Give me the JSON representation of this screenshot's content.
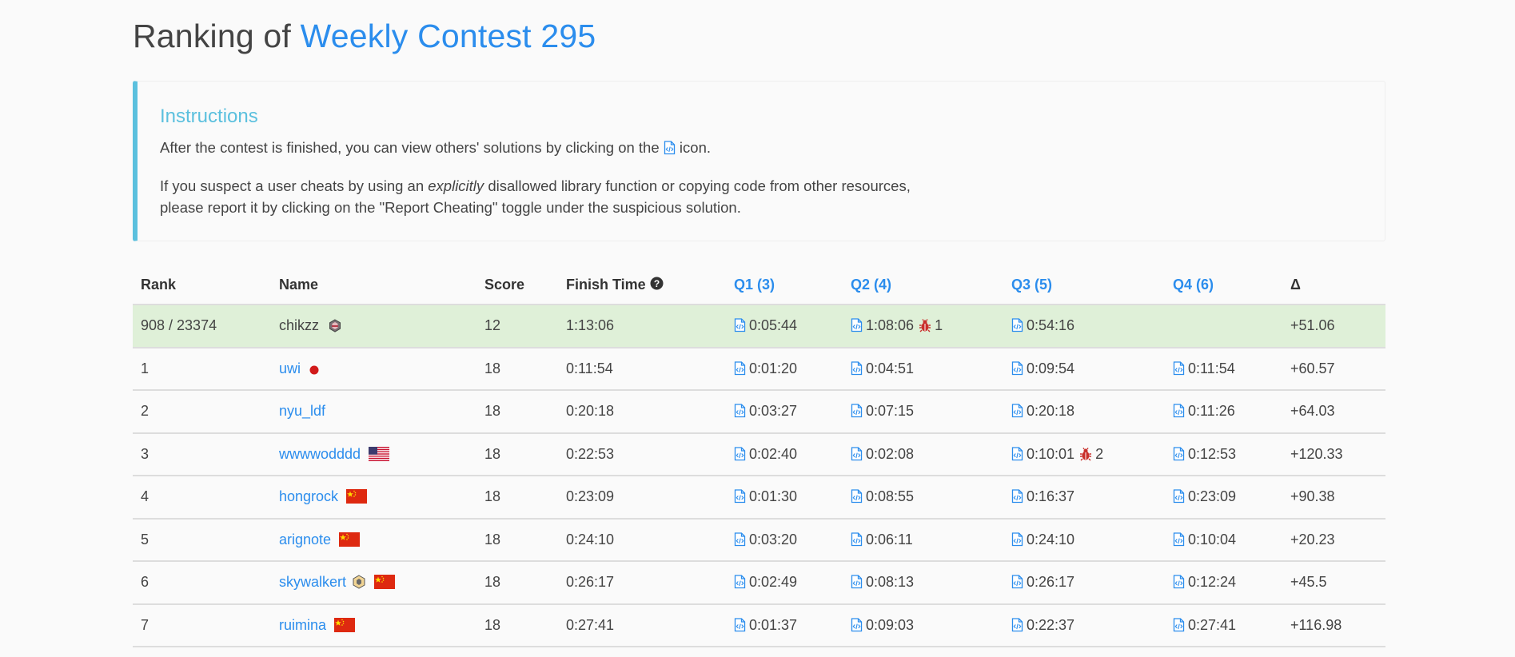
{
  "page": {
    "title_prefix": "Ranking of",
    "contest_name": "Weekly Contest 295"
  },
  "instructions": {
    "heading": "Instructions",
    "line1_before": "After the contest is finished, you can view others' solutions by clicking on the",
    "line1_after": "icon.",
    "line2_before": "If you suspect a user cheats by using an",
    "line2_em": "explicitly",
    "line2_after": "disallowed library function or copying code from other resources,",
    "line3": "please report it by clicking on the \"Report Cheating\" toggle under the suspicious solution."
  },
  "table": {
    "headers": {
      "rank": "Rank",
      "name": "Name",
      "score": "Score",
      "finish_time": "Finish Time",
      "q1": "Q1 (3)",
      "q2": "Q2 (4)",
      "q3": "Q3 (5)",
      "q4": "Q4 (6)",
      "delta": "Δ"
    },
    "my_row": {
      "rank": "908 / 23374",
      "name": "chikzz",
      "score": "12",
      "finish_time": "1:13:06",
      "q1": "0:05:44",
      "q2": "1:08:06",
      "q2_bugs": "1",
      "q3": "0:54:16",
      "q4": "",
      "delta": "+51.06"
    },
    "rows": [
      {
        "rank": "1",
        "name": "uwi",
        "score": "18",
        "finish_time": "0:11:54",
        "q1": "0:01:20",
        "q2": "0:04:51",
        "q3": "0:09:54",
        "q4": "0:11:54",
        "delta": "+60.57"
      },
      {
        "rank": "2",
        "name": "nyu_ldf",
        "score": "18",
        "finish_time": "0:20:18",
        "q1": "0:03:27",
        "q2": "0:07:15",
        "q3": "0:20:18",
        "q4": "0:11:26",
        "delta": "+64.03"
      },
      {
        "rank": "3",
        "name": "wwwwodddd",
        "score": "18",
        "finish_time": "0:22:53",
        "q1": "0:02:40",
        "q2": "0:02:08",
        "q3": "0:10:01",
        "q3_bugs": "2",
        "q4": "0:12:53",
        "delta": "+120.33"
      },
      {
        "rank": "4",
        "name": "hongrock",
        "score": "18",
        "finish_time": "0:23:09",
        "q1": "0:01:30",
        "q2": "0:08:55",
        "q3": "0:16:37",
        "q4": "0:23:09",
        "delta": "+90.38"
      },
      {
        "rank": "5",
        "name": "arignote",
        "score": "18",
        "finish_time": "0:24:10",
        "q1": "0:03:20",
        "q2": "0:06:11",
        "q3": "0:24:10",
        "q4": "0:10:04",
        "delta": "+20.23"
      },
      {
        "rank": "6",
        "name": "skywalkert",
        "score": "18",
        "finish_time": "0:26:17",
        "q1": "0:02:49",
        "q2": "0:08:13",
        "q3": "0:26:17",
        "q4": "0:12:24",
        "delta": "+45.5"
      },
      {
        "rank": "7",
        "name": "ruimina",
        "score": "18",
        "finish_time": "0:27:41",
        "q1": "0:01:37",
        "q2": "0:09:03",
        "q3": "0:22:37",
        "q4": "0:27:41",
        "delta": "+116.98"
      }
    ]
  },
  "colors": {
    "link_blue": "#2b8ded",
    "callout_accent": "#5bc0de",
    "my_row_bg": "#dff0d8",
    "delta_green": "#3c8b2e",
    "bug_red": "#c9302c"
  },
  "icons": {
    "code": "code-file-icon",
    "bug": "bug-icon",
    "help": "question-circle-icon",
    "flag_jp": "flag-japan-icon",
    "flag_us": "flag-usa-icon",
    "flag_cn": "flag-china-icon",
    "badge": "contest-badge-icon"
  }
}
